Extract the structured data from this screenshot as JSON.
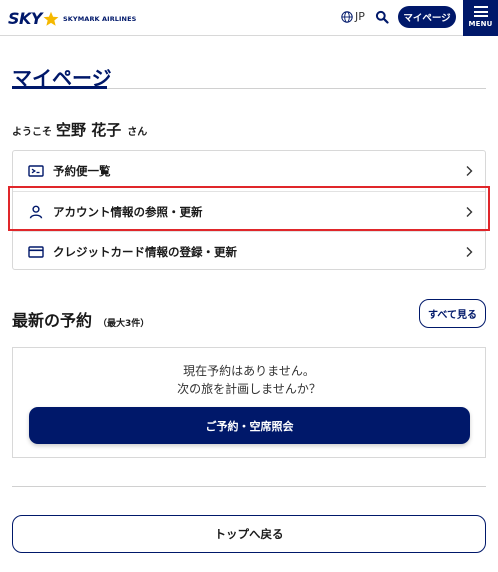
{
  "header": {
    "logo_text": "SKY",
    "logo_subtext": "SKYMARK AIRLINES",
    "language_label": "JP",
    "mypage_label": "マイページ",
    "menu_label": "MENU",
    "brand_color": "#00186a",
    "star_color": "#f5b800"
  },
  "page": {
    "title": "マイページ"
  },
  "welcome": {
    "prefix": "ようこそ",
    "name": "空野 花子",
    "suffix": "さん"
  },
  "menu": {
    "items": [
      {
        "label": "予約便一覧",
        "icon": "ticket-icon"
      },
      {
        "label": "アカウント情報の参照・更新",
        "icon": "person-icon"
      },
      {
        "label": "クレジットカード情報の登録・更新",
        "icon": "credit-card-icon"
      }
    ],
    "highlight_color": "#e0262a"
  },
  "reservations": {
    "title": "最新の予約",
    "subtitle": "（最大3件）",
    "see_all_label": "すべて見る",
    "empty_line1": "現在予約はありません。",
    "empty_line2": "次の旅を計画しませんか？",
    "book_button_label": "ご予約・空席照会"
  },
  "footer": {
    "back_to_top_label": "トップへ戻る"
  }
}
